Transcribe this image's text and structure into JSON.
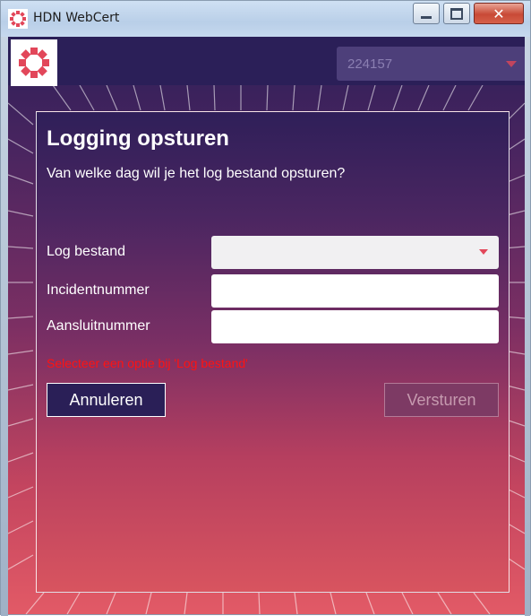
{
  "window": {
    "title": "HDN WebCert",
    "close_glyph": "✕"
  },
  "header": {
    "account_value": "224157"
  },
  "dialog": {
    "title": "Logging opsturen",
    "question": "Van welke dag wil je het log bestand opsturen?",
    "fields": [
      {
        "label": "Log bestand",
        "value": ""
      },
      {
        "label": "Incidentnummer",
        "value": ""
      },
      {
        "label": "Aansluitnummer",
        "value": ""
      }
    ],
    "error": "Selecteer een optie bij 'Log bestand'",
    "cancel_label": "Annuleren",
    "send_label": "Versturen"
  },
  "colors": {
    "header_bg": "#2b1f58",
    "accent": "#e2475a",
    "error": "#ff1212"
  },
  "icons": [
    "app-logo-icon",
    "minimize-icon",
    "maximize-icon",
    "close-icon",
    "chevron-down-icon"
  ]
}
